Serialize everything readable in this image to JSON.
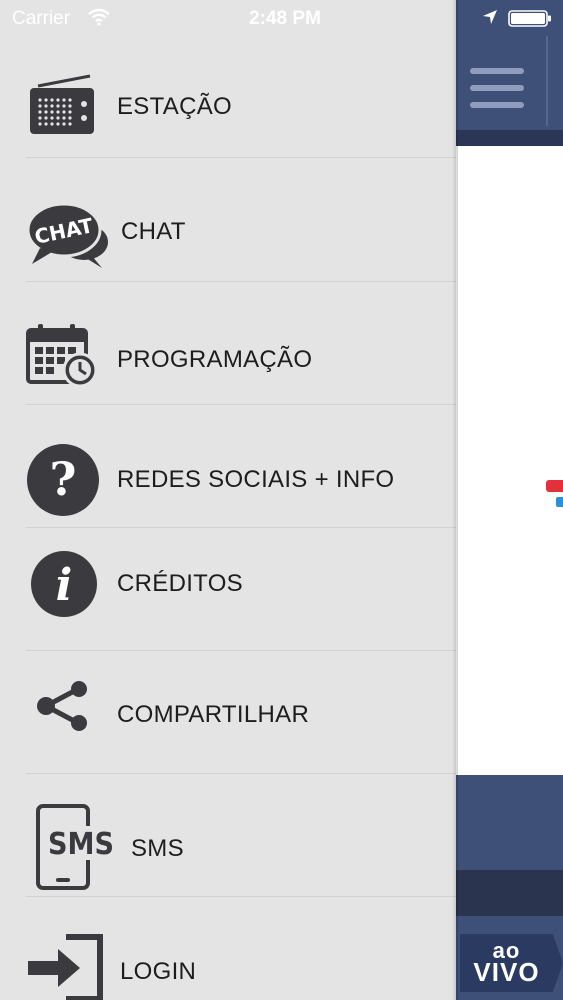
{
  "status_bar": {
    "carrier": "Carrier",
    "time": "2:48 PM",
    "icons": [
      "wifi-icon",
      "location-arrow-icon",
      "battery-icon"
    ]
  },
  "menu": {
    "items": [
      {
        "label": "ESTAÇÃO",
        "icon": "radio-icon"
      },
      {
        "label": "CHAT",
        "icon": "chat-icon",
        "icon_text": "CHAT"
      },
      {
        "label": "PROGRAMAÇÃO",
        "icon": "calendar-clock-icon"
      },
      {
        "label": "REDES SOCIAIS + INFO",
        "icon": "question-icon"
      },
      {
        "label": "CRÉDITOS",
        "icon": "info-icon"
      },
      {
        "label": "COMPARTILHAR",
        "icon": "share-icon"
      },
      {
        "label": "SMS",
        "icon": "sms-phone-icon",
        "icon_text": "SMS"
      },
      {
        "label": "LOGIN",
        "icon": "login-icon"
      }
    ]
  },
  "app": {
    "live_badge": {
      "line1": "ao",
      "line2": "VIVO"
    },
    "colors": {
      "bar": "#3e4f78",
      "bar_dark": "#2a344f",
      "drawer_bg": "#e4e4e4",
      "icon": "#3b3b3f"
    }
  }
}
